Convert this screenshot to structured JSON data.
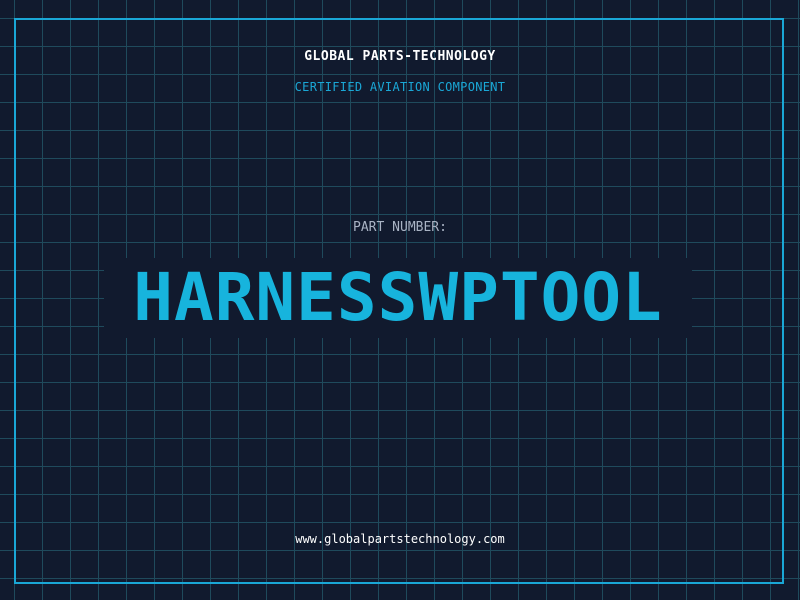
{
  "header": {
    "company": "GLOBAL PARTS-TECHNOLOGY",
    "subtitle": "CERTIFIED AVIATION COMPONENT"
  },
  "part": {
    "label": "PART NUMBER:",
    "number": "HARNESSWPTOOL"
  },
  "footer": {
    "website": "www.globalpartstechnology.com"
  },
  "colors": {
    "background": "#111a2e",
    "grid": "#1f4a5c",
    "accent": "#1aa7d6",
    "text": "#ffffff",
    "muted": "#a9b3c4"
  }
}
